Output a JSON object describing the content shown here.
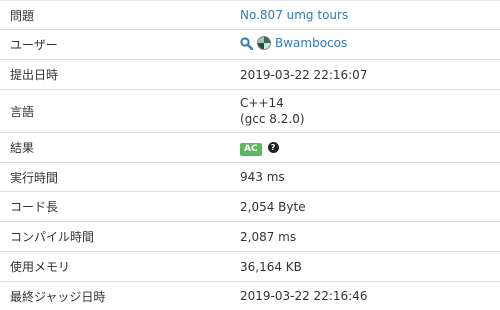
{
  "rows": {
    "problem": {
      "label": "問題",
      "value": "No.807 umg tours"
    },
    "user": {
      "label": "ユーザー",
      "value": "Bwambocos",
      "search_icon": "search-icon"
    },
    "submitted": {
      "label": "提出日時",
      "value": "2019-03-22 22:16:07"
    },
    "language": {
      "label": "言語",
      "value_line1": "C++14",
      "value_line2": "(gcc 8.2.0)"
    },
    "result": {
      "label": "結果",
      "badge": "AC",
      "help_glyph": "?"
    },
    "exec_time": {
      "label": "実行時間",
      "value": "943 ms"
    },
    "code_length": {
      "label": "コード長",
      "value": "2,054 Byte"
    },
    "compile_time": {
      "label": "コンパイル時間",
      "value": "2,087 ms"
    },
    "memory": {
      "label": "使用メモリ",
      "value": "36,164 KB"
    },
    "last_judge": {
      "label": "最終ジャッジ日時",
      "value": "2019-03-22 22:16:46"
    }
  },
  "colors": {
    "link": "#337ab7",
    "badge_ac": "#5cb85c"
  }
}
